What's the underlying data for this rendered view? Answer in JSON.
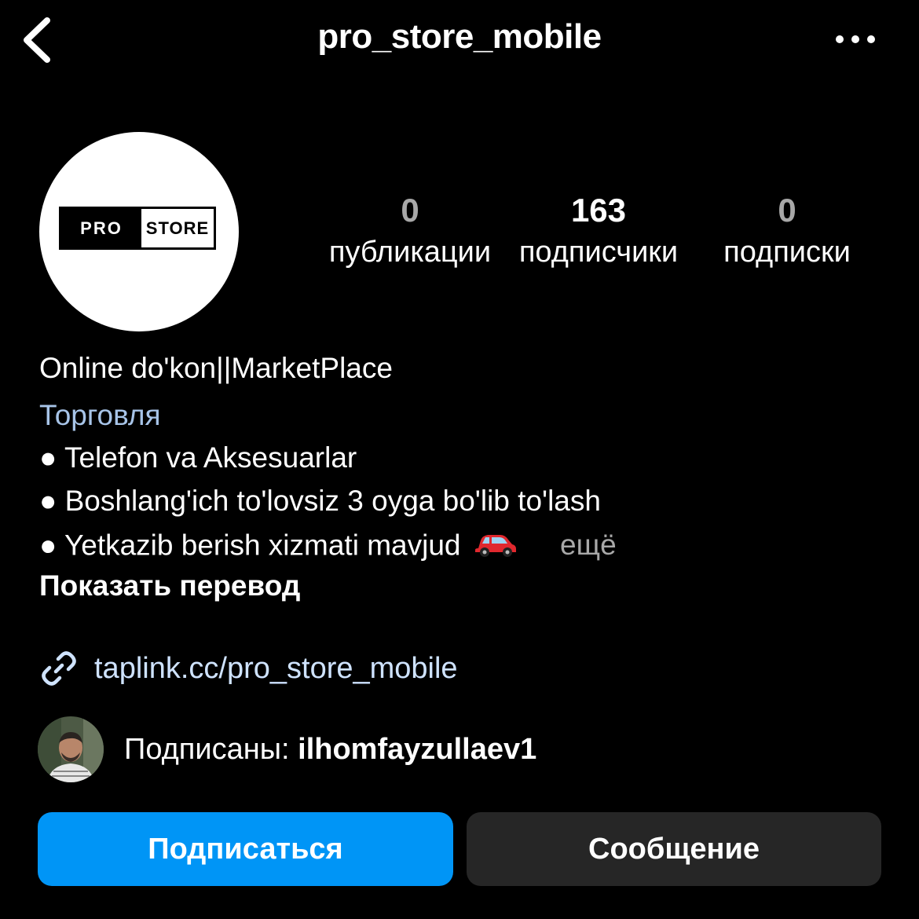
{
  "header": {
    "username": "pro_store_mobile",
    "back_icon": "chevron-left-icon",
    "more_icon": "more-horizontal-icon"
  },
  "avatar": {
    "logo_left": "PRO",
    "logo_right": "STORE"
  },
  "stats": {
    "posts": {
      "value": "0",
      "label": "публикации"
    },
    "followers": {
      "value": "163",
      "label": "подписчики"
    },
    "following": {
      "value": "0",
      "label": "подписки"
    }
  },
  "bio": {
    "name": "Online do'kon||MarketPlace",
    "category": "Торговля",
    "line1": "● Telefon va Aksesuarlar",
    "line2": "● Boshlang'ich to'lovsiz 3 oyga bo'lib to'lash",
    "line3": "● Yetkazib berish xizmati mavjud",
    "line3_icon": "car-icon",
    "more": "ещё",
    "translate": "Показать перевод"
  },
  "link": {
    "icon": "link-icon",
    "url": "taplink.cc/pro_store_mobile"
  },
  "followed_by": {
    "prefix": "Подписаны: ",
    "username": "ilhomfayzullaev1"
  },
  "buttons": {
    "follow": "Подписаться",
    "message": "Сообщение"
  },
  "colors": {
    "background": "#000000",
    "follow_button": "#0095f6",
    "message_button": "#262626",
    "category_text": "#a7c4e8",
    "link_text": "#cfe3ff",
    "muted_text": "#a8a8a8"
  }
}
